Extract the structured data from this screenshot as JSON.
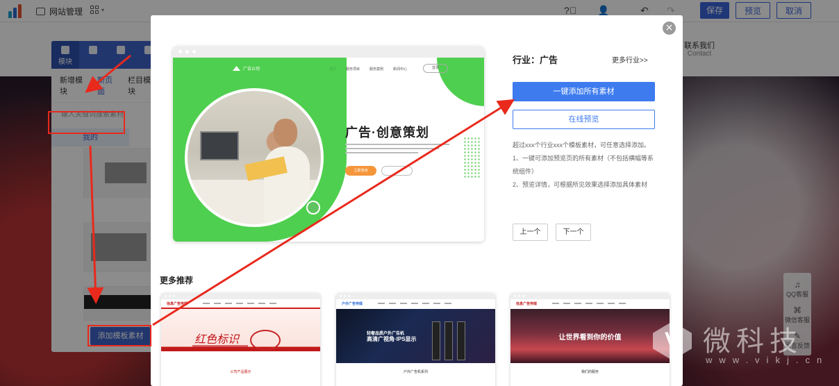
{
  "toolbar": {
    "site_manage": "网站管理",
    "save": "保存",
    "preview": "预览",
    "cancel": "取消",
    "icons": [
      "help-icon",
      "user-icon",
      "undo-icon",
      "redo-icon"
    ]
  },
  "site": {
    "contact_cn": "联系我们",
    "contact_en": "Contact"
  },
  "side_tools": [
    {
      "icon": "qq-icon",
      "label": "QQ客服"
    },
    {
      "icon": "wechat-icon",
      "label": "微信客服"
    },
    {
      "icon": "feedback-icon",
      "label": "留言反馈"
    }
  ],
  "panel": {
    "tabs": [
      {
        "label": "模块",
        "icon": "module-icon"
      },
      {
        "label": "",
        "icon": "shirt-icon"
      },
      {
        "label": "",
        "icon": "gear-icon"
      },
      {
        "label": "",
        "icon": "paw-icon"
      }
    ],
    "subtabs": [
      "新增模块",
      "新页面",
      "栏目模块"
    ],
    "search_placeholder": "输入关键词搜索素材",
    "mine": "我的",
    "add_template": "添加模板素材"
  },
  "modal": {
    "preview": {
      "brand": "广告公司",
      "menu": [
        "首页",
        "服务项目",
        "服务案例",
        "新闻中心"
      ],
      "pill": "登录",
      "title": "广告·创意策划",
      "btn": "立即咨询"
    },
    "industry": "行业：广告",
    "more_industry": "更多行业>>",
    "add_all": "一键添加所有素材",
    "online_preview": "在线预览",
    "info": [
      "超过xxx个行业xxx个模板素材，可任意选择添加。",
      "1、一键可添加预览页的所有素材（不包括横幅等系统组件）",
      "2、预览详情，可根据所见效果选择添加具体素材"
    ],
    "prev": "上一个",
    "next": "下一个",
    "more_recommend": "更多推荐",
    "cards": [
      {
        "brand": "信息广告传媒",
        "script": "红色标识",
        "footer": "公司产品展示"
      },
      {
        "brand": "户外广告传媒",
        "caption_small": "轻奢品质户外广告机",
        "caption": "高清广视角·IPS显示",
        "footer": "户外广告机系列"
      },
      {
        "brand": "信息广告传媒",
        "caption": "让世界看到你的价值",
        "footer": "我们的服务"
      }
    ]
  },
  "watermark": {
    "logo_letter": "V",
    "text": "微科技",
    "url": "www.vikj.cn"
  },
  "colors": {
    "primary": "#3b65d9",
    "modal_primary": "#3d7bef",
    "annotation": "#e8291c",
    "preview_green": "#4fcf4f"
  }
}
